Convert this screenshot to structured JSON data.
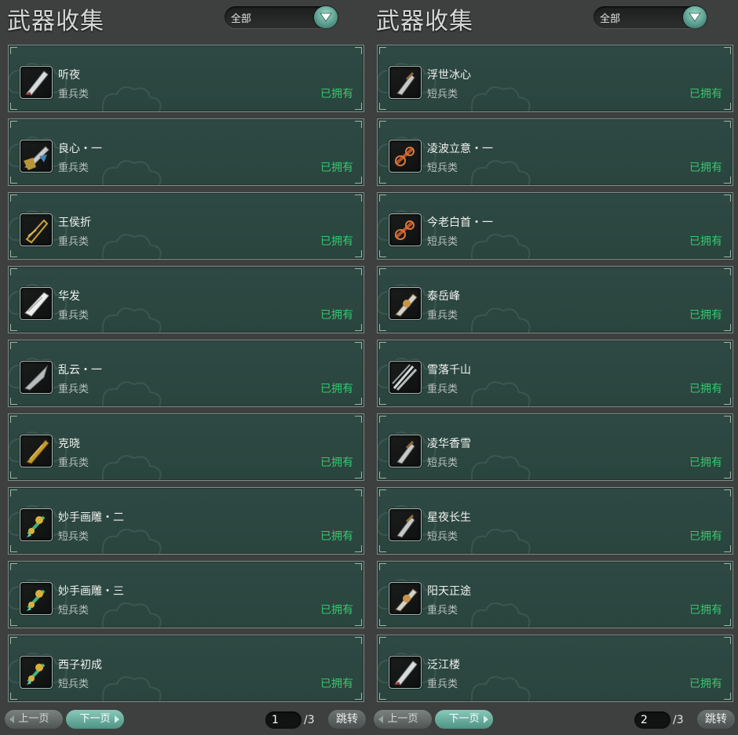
{
  "colors": {
    "owned": "#35c86e",
    "accent": "#5aa897"
  },
  "panels": [
    {
      "title": "武器收集",
      "filter": "全部",
      "items": [
        {
          "name": "听夜",
          "type": "重兵类",
          "status": "已拥有",
          "icon": "heavy-blade-silver-icon"
        },
        {
          "name": "良心・一",
          "type": "重兵类",
          "status": "已拥有",
          "icon": "heavy-blade-ornate-icon"
        },
        {
          "name": "王侯折",
          "type": "重兵类",
          "status": "已拥有",
          "icon": "heavy-blade-gold-icon"
        },
        {
          "name": "华发",
          "type": "重兵类",
          "status": "已拥有",
          "icon": "heavy-blade-white-icon"
        },
        {
          "name": "乱云・一",
          "type": "重兵类",
          "status": "已拥有",
          "icon": "heavy-blade-steel-icon"
        },
        {
          "name": "克晓",
          "type": "重兵类",
          "status": "已拥有",
          "icon": "heavy-blade-golden-icon"
        },
        {
          "name": "妙手画雕・二",
          "type": "短兵类",
          "status": "已拥有",
          "icon": "short-weapon-jade-icon"
        },
        {
          "name": "妙手画雕・三",
          "type": "短兵类",
          "status": "已拥有",
          "icon": "short-weapon-jade-icon"
        },
        {
          "name": "西子初成",
          "type": "短兵类",
          "status": "已拥有",
          "icon": "short-weapon-jade-icon"
        }
      ],
      "pager": {
        "prev": "上一页",
        "next": "下一页",
        "current": "1",
        "total": "/3",
        "jump": "跳转"
      }
    },
    {
      "title": "武器收集",
      "filter": "全部",
      "items": [
        {
          "name": "浮世冰心",
          "type": "短兵类",
          "status": "已拥有",
          "icon": "short-weapon-dagger-icon"
        },
        {
          "name": "凌波立意・一",
          "type": "短兵类",
          "status": "已拥有",
          "icon": "short-weapon-red-icon"
        },
        {
          "name": "今老白首・一",
          "type": "短兵类",
          "status": "已拥有",
          "icon": "short-weapon-red-icon"
        },
        {
          "name": "泰岳峰",
          "type": "重兵类",
          "status": "已拥有",
          "icon": "heavy-blade-bronze-icon"
        },
        {
          "name": "雪落千山",
          "type": "重兵类",
          "status": "已拥有",
          "icon": "heavy-blade-triple-icon"
        },
        {
          "name": "凌华香雪",
          "type": "短兵类",
          "status": "已拥有",
          "icon": "short-weapon-dagger-icon"
        },
        {
          "name": "星夜长生",
          "type": "短兵类",
          "status": "已拥有",
          "icon": "short-weapon-dagger-icon"
        },
        {
          "name": "阳天正途",
          "type": "重兵类",
          "status": "已拥有",
          "icon": "heavy-blade-bronze-icon"
        },
        {
          "name": "泛江楼",
          "type": "重兵类",
          "status": "已拥有",
          "icon": "heavy-blade-silver-icon"
        }
      ],
      "pager": {
        "prev": "上一页",
        "next": "下一页",
        "current": "2",
        "total": "/3",
        "jump": "跳转"
      }
    }
  ]
}
